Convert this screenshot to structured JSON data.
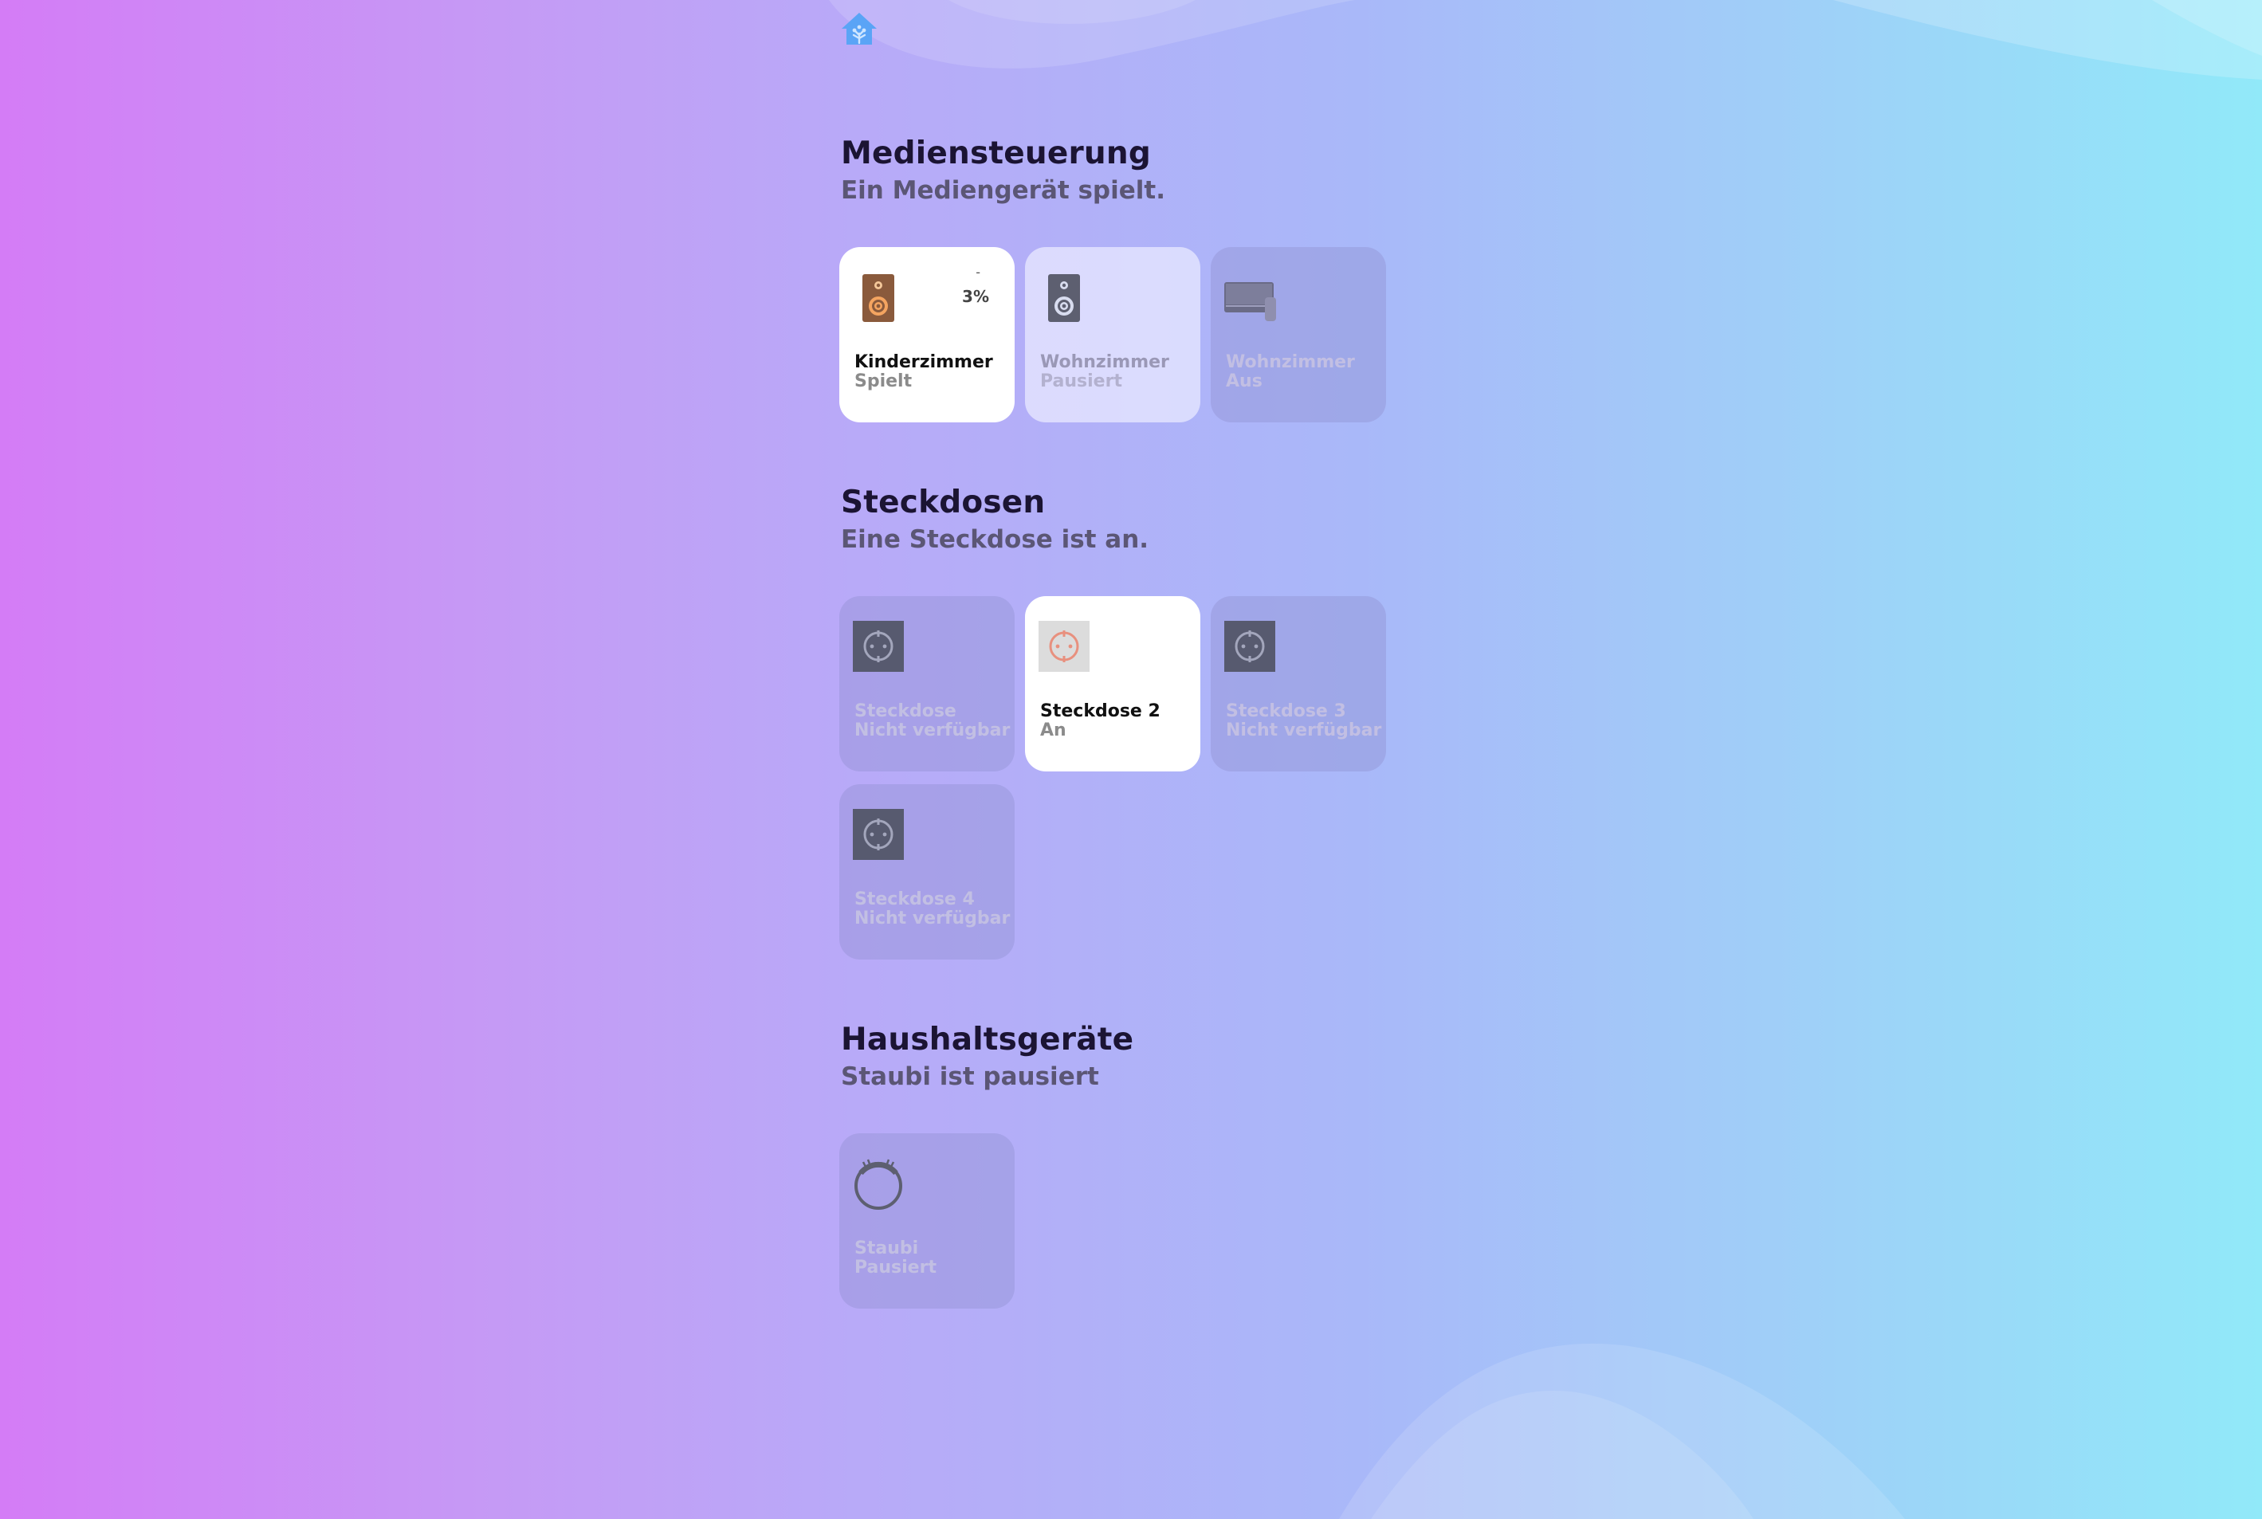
{
  "header": {
    "home_icon": "home-icon"
  },
  "sections": [
    {
      "title": "Mediensteuerung",
      "subtitle": "Ein Mediengerät spielt.",
      "tiles": [
        {
          "name": "Kinderzimmer",
          "state": "Spielt",
          "status": "on",
          "icon": "speaker-icon",
          "volume": "3%",
          "volume_dash": "-"
        },
        {
          "name": "Wohnzimmer",
          "state": "Pausiert",
          "status": "paused",
          "icon": "speaker-icon"
        },
        {
          "name": "Wohnzimmer",
          "state": "Aus",
          "status": "off",
          "icon": "tv-icon"
        }
      ]
    },
    {
      "title": "Steckdosen",
      "subtitle": "Eine Steckdose ist an.",
      "tiles": [
        {
          "name": "Steckdose",
          "state": "Nicht verfügbar",
          "status": "off",
          "icon": "outlet-icon"
        },
        {
          "name": "Steckdose 2",
          "state": "An",
          "status": "on",
          "icon": "outlet-icon"
        },
        {
          "name": "Steckdose 3",
          "state": "Nicht verfügbar",
          "status": "off",
          "icon": "outlet-icon"
        },
        {
          "name": "Steckdose 4",
          "state": "Nicht verfügbar",
          "status": "off",
          "icon": "outlet-icon"
        }
      ]
    },
    {
      "title": "Haushaltsgeräte",
      "subtitle": "Staubi ist pausiert",
      "tiles": [
        {
          "name": "Staubi",
          "state": "Pausiert",
          "status": "off",
          "icon": "robot-vacuum-icon"
        }
      ]
    }
  ],
  "colors": {
    "title": "#1b1433",
    "subtitle": "#5b5675",
    "outlet_on_accent": "#e8907e",
    "home_icon": "#5aa4f6"
  }
}
